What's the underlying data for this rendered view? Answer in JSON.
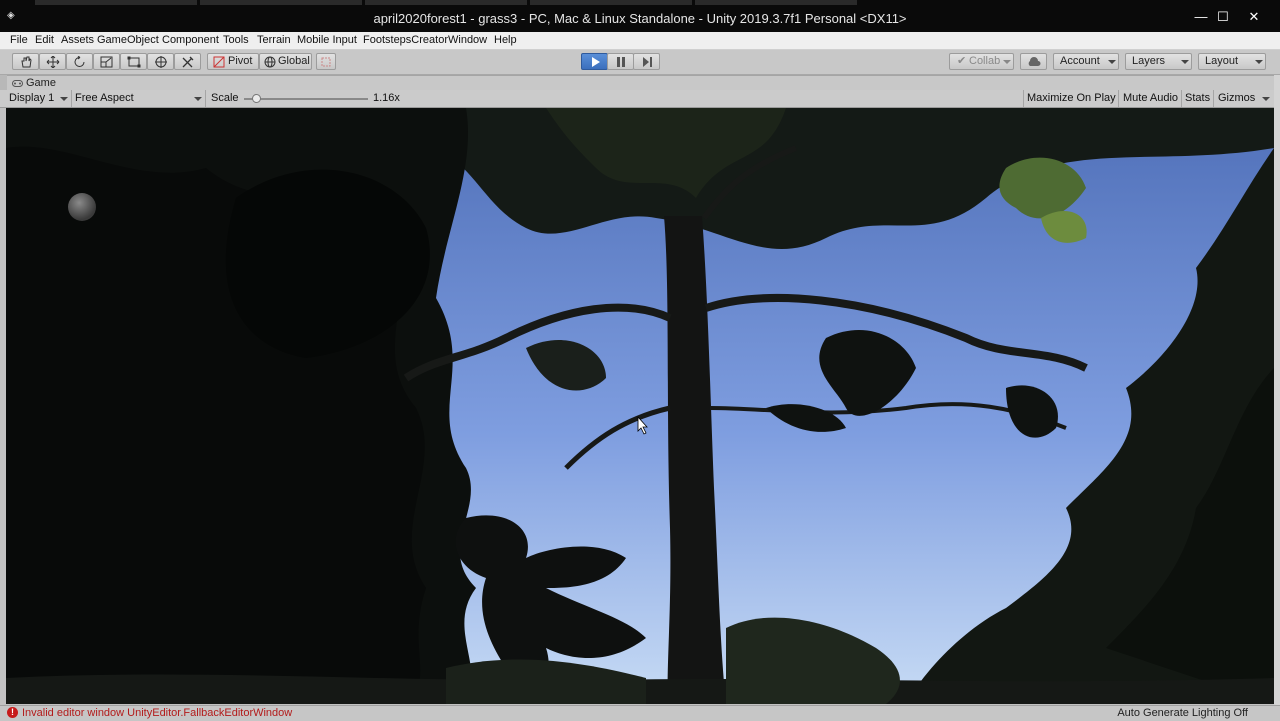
{
  "window": {
    "title": "april2020forest1 - grass3 - PC, Mac & Linux Standalone - Unity 2019.3.7f1 Personal <DX11>",
    "minimize_glyph": "—",
    "maximize_glyph": "☐",
    "close_glyph": "✕"
  },
  "menu": [
    "File",
    "Edit",
    "Assets",
    "GameObject",
    "Component",
    "Tools",
    "Terrain",
    "Mobile Input",
    "FootstepsCreator",
    "Window",
    "Help"
  ],
  "toolbar": {
    "tools": [
      "hand-tool-icon",
      "move-tool-icon",
      "rotate-tool-icon",
      "scale-tool-icon",
      "rect-tool-icon",
      "transform-tool-icon",
      "custom-tool-icon"
    ],
    "pivot_label": "Pivot",
    "global_label": "Global",
    "collab_label": "Collab",
    "account_label": "Account",
    "layers_label": "Layers",
    "layout_label": "Layout",
    "play_state": "playing",
    "accent_color": "#3b6fbd"
  },
  "game_view": {
    "tab_label": "Game",
    "display_label": "Display 1",
    "aspect_label": "Free Aspect",
    "scale_label": "Scale",
    "scale_value": "1.16x",
    "scale_fraction": 0.1,
    "maximize_on_play": "Maximize On Play",
    "mute_audio": "Mute Audio",
    "stats": "Stats",
    "gizmos": "Gizmos"
  },
  "status": {
    "error_message": "Invalid editor window UnityEditor.FallbackEditorWindow",
    "error_color": "#b31b1b",
    "right_text": "Auto Generate Lighting Off"
  }
}
